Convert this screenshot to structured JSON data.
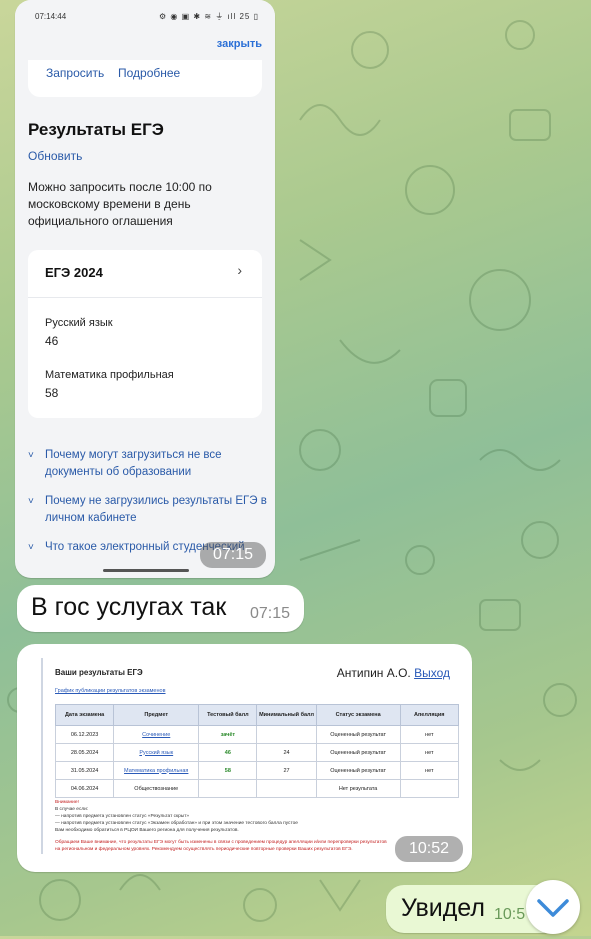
{
  "chat": {
    "messages": [
      {
        "kind": "image",
        "time": "07:15"
      },
      {
        "kind": "text",
        "text": "В гос услугах так",
        "time": "07:15"
      },
      {
        "kind": "image",
        "time": "10:52"
      },
      {
        "kind": "text",
        "text": "Увидел",
        "time": "10:5"
      }
    ],
    "scroll_down_icon": "chevron-down-icon"
  },
  "phone_screenshot": {
    "status_time": "07:14:44",
    "status_icons": "⚙ ◉   ▣ ✱ ≋ ⏚ ıll 25 ▯",
    "close_label": "закрыть",
    "top_actions": [
      "Запросить",
      "Подробнее"
    ],
    "section_title": "Результаты ЕГЭ",
    "refresh_label": "Обновить",
    "description": "Можно запросить после 10:00 по московскому времени в день официального оглашения",
    "card_title": "ЕГЭ 2024",
    "results": [
      {
        "subject": "Русский язык",
        "score": "46"
      },
      {
        "subject": "Математика профильная",
        "score": "58"
      }
    ],
    "faq": [
      "Почему могут загрузиться не все документы об образовании",
      "Почему не загрузились результаты ЕГЭ в личном кабинете",
      "Что такое электронный студенческий"
    ]
  },
  "web_screenshot": {
    "title": "Ваши результаты ЕГЭ",
    "user": "Антипин А.О.",
    "logout": "Выход",
    "schedule_link": "График публикации результатов экзаменов",
    "columns": [
      "Дата экзамена",
      "Предмет",
      "Тестовый балл",
      "Минимальный балл",
      "Статус экзамена",
      "Апелляция"
    ],
    "rows": [
      [
        "06.12.2023",
        "Сочинение",
        "зачёт",
        "",
        "Оцененный результат",
        "нет"
      ],
      [
        "28.05.2024",
        "Русский язык",
        "46",
        "24",
        "Оцененный результат",
        "нет"
      ],
      [
        "31.05.2024",
        "Математика профильная",
        "58",
        "27",
        "Оцененный результат",
        "нет"
      ],
      [
        "04.06.2024",
        "Обществознание",
        "",
        "",
        "Нет результата",
        ""
      ]
    ],
    "note_title": "Внимание!",
    "note_lines": [
      "В случае если:",
      "— напротив предмета установлен статус «Результат скрыт»",
      "— напротив предмета установлен статус «Экзамен обработан» и при этом значение тестового балла пустое",
      "Вам необходимо обратиться в РЦОИ Вашего региона для получения результатов."
    ],
    "warning_lines": [
      "Обращаем Ваше внимание, что результаты ЕГЭ могут быть изменены в связи с проведением процедур апелляции и/или перепроверки результатов",
      "на региональном и федеральном уровнях. Рекомендуем осуществлять периодические повторные проверки Ваших результатов ЕГЭ."
    ]
  }
}
